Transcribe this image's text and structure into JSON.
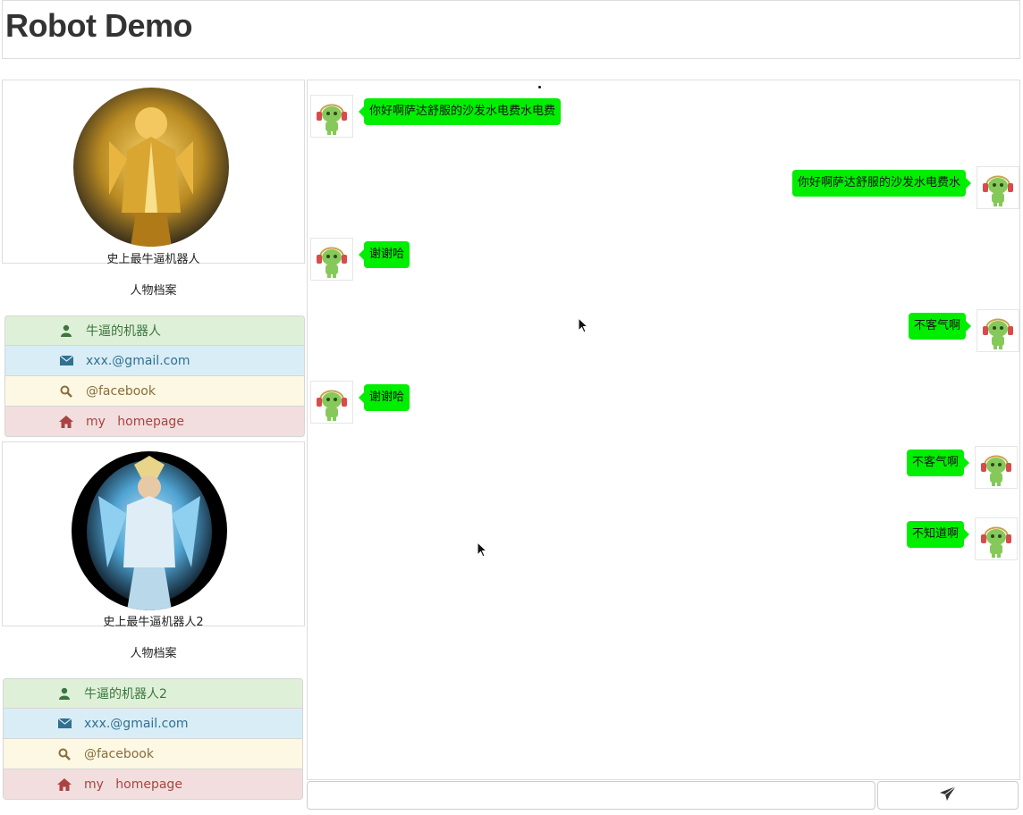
{
  "header": {
    "title": "Robot Demo"
  },
  "profiles": [
    {
      "name": "史上最牛逼机器人",
      "archive_title": "人物档案",
      "items": [
        {
          "icon": "user-icon",
          "text": "牛逼的机器人"
        },
        {
          "icon": "envelope-icon",
          "text": "xxx.@gmail.com"
        },
        {
          "icon": "search-icon",
          "text": "@facebook"
        },
        {
          "icon": "home-icon",
          "text": "my   homepage"
        }
      ]
    },
    {
      "name": "史上最牛逼机器人2",
      "archive_title": "人物档案",
      "items": [
        {
          "icon": "user-icon",
          "text": "牛逼的机器人2"
        },
        {
          "icon": "envelope-icon",
          "text": "xxx.@gmail.com"
        },
        {
          "icon": "search-icon",
          "text": "@facebook"
        },
        {
          "icon": "home-icon",
          "text": "my   homepage"
        }
      ]
    }
  ],
  "messages": [
    {
      "side": "left",
      "text": "你好啊萨达舒服的沙发水电费水电费"
    },
    {
      "side": "right",
      "text": "你好啊萨达舒服的沙发水电费水"
    },
    {
      "side": "left",
      "text": "谢谢哈"
    },
    {
      "side": "right",
      "text": "不客气啊"
    },
    {
      "side": "left",
      "text": "谢谢哈"
    },
    {
      "side": "right",
      "text": "不客气啊"
    },
    {
      "side": "right",
      "text": "不知道啊"
    }
  ],
  "input": {
    "value": "",
    "send_icon": "send-icon"
  },
  "colors": {
    "bubble": "#00ee00",
    "green_item": "#dff0d8",
    "blue_item": "#d9edf7",
    "yellow_item": "#fcf8e3",
    "red_item": "#f2dede"
  }
}
